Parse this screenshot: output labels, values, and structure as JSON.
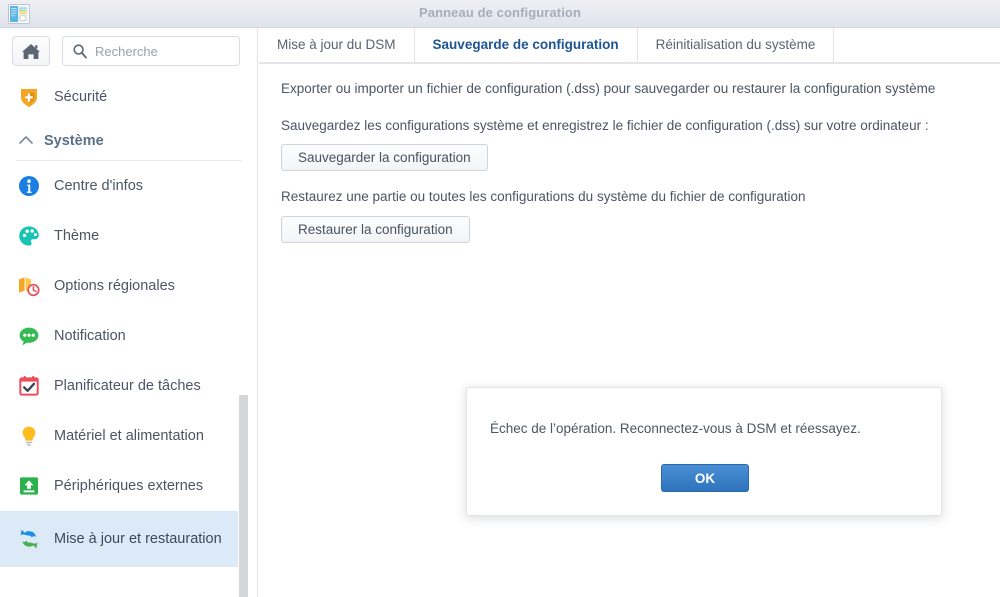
{
  "window": {
    "title": "Panneau de configuration",
    "app_icon": "control-panel-icon"
  },
  "sidebar": {
    "home_button_icon": "home-icon",
    "search": {
      "icon": "search-icon",
      "placeholder": "Recherche",
      "value": ""
    },
    "top_items": [
      {
        "label": "Sécurité",
        "icon": "shield-icon",
        "selected": false
      }
    ],
    "group": {
      "label": "Système",
      "caret_icon": "chevron-up-icon",
      "expanded": true
    },
    "items": [
      {
        "label": "Centre d'infos",
        "icon": "info-icon",
        "selected": false
      },
      {
        "label": "Thème",
        "icon": "palette-icon",
        "selected": false
      },
      {
        "label": "Options régionales",
        "icon": "regional-map-clock-icon",
        "selected": false
      },
      {
        "label": "Notification",
        "icon": "speech-bubble-icon",
        "selected": false
      },
      {
        "label": "Planificateur de tâches",
        "icon": "calendar-check-icon",
        "selected": false
      },
      {
        "label": "Matériel et alimentation",
        "icon": "lightbulb-icon",
        "selected": false
      },
      {
        "label": "Périphériques externes",
        "icon": "external-device-icon",
        "selected": false
      },
      {
        "label": "Mise à jour et restauration",
        "icon": "refresh-arrows-icon",
        "selected": true
      }
    ]
  },
  "main": {
    "tabs": [
      {
        "label": "Mise à jour du DSM",
        "active": false
      },
      {
        "label": "Sauvegarde de configuration",
        "active": true
      },
      {
        "label": "Réinitialisation du système",
        "active": false
      }
    ],
    "paragraph_1": "Exporter ou importer un fichier de configuration (.dss) pour sauvegarder ou restaurer la configuration système",
    "paragraph_2": "Sauvegardez les configurations système et enregistrez le fichier de configuration (.dss) sur votre ordinateur :",
    "backup_button": "Sauvegarder la configuration",
    "paragraph_3": "Restaurez une partie ou toutes les configurations du système du fichier de configuration",
    "restore_button": "Restaurer la configuration"
  },
  "dialog": {
    "message": "Échec de l’opération. Reconnectez-vous à DSM et réessayez.",
    "ok_label": "OK"
  },
  "colors": {
    "accent_blue": "#1d5496",
    "selected_item_bg": "#dceaf8",
    "primary_button": "#2f73bd",
    "title_text": "#a7adba",
    "body_text": "#4c5563"
  }
}
